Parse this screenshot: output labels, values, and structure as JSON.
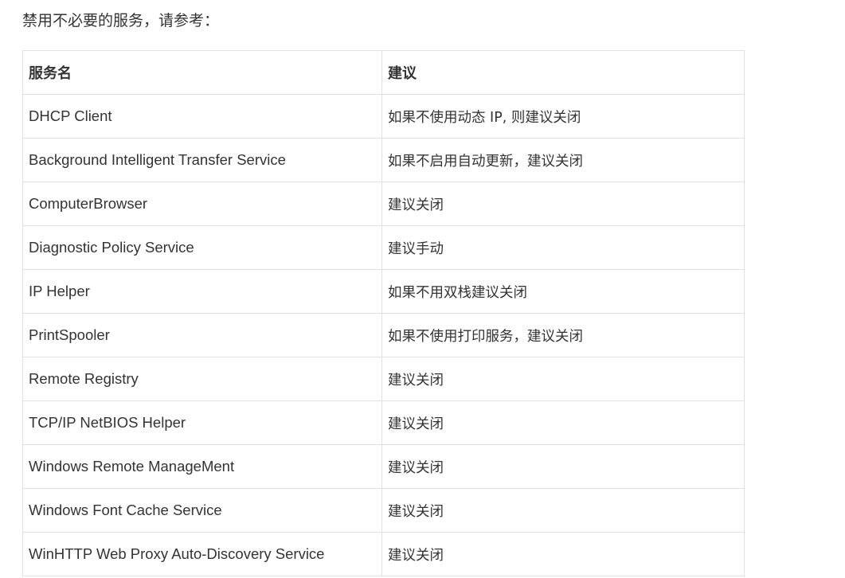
{
  "intro": "禁用不必要的服务，请参考：",
  "table": {
    "headers": [
      "服务名",
      "建议"
    ],
    "rows": [
      [
        "DHCP Client",
        "如果不使用动态 IP, 则建议关闭"
      ],
      [
        "Background Intelligent Transfer Service",
        "如果不启用自动更新，建议关闭"
      ],
      [
        "ComputerBrowser",
        "建议关闭"
      ],
      [
        "Diagnostic Policy Service",
        "建议手动"
      ],
      [
        "IP Helper",
        "如果不用双栈建议关闭"
      ],
      [
        "PrintSpooler",
        "如果不使用打印服务，建议关闭"
      ],
      [
        "Remote Registry",
        "建议关闭"
      ],
      [
        "TCP/IP NetBIOS Helper",
        "建议关闭"
      ],
      [
        "Windows Remote ManageMent",
        "建议关闭"
      ],
      [
        "Windows Font Cache Service",
        "建议关闭"
      ],
      [
        "WinHTTP Web Proxy Auto-Discovery Service",
        "建议关闭"
      ]
    ]
  }
}
